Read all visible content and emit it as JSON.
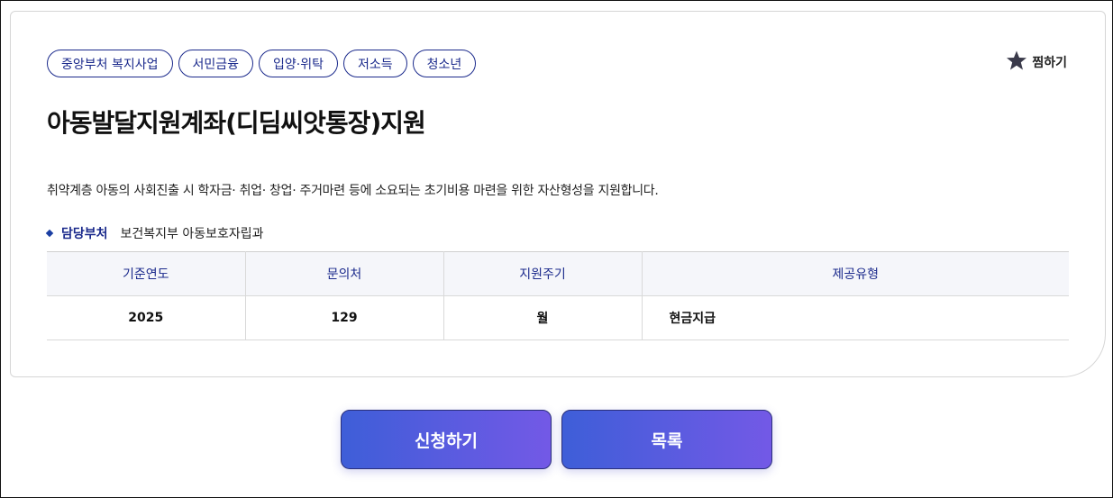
{
  "tags": [
    "중앙부처 복지사업",
    "서민금융",
    "입양·위탁",
    "저소득",
    "청소년"
  ],
  "bookmark": {
    "label": "찜하기",
    "icon": "star-icon",
    "color": "#3a3a4a"
  },
  "title": "아동발달지원계좌(디딤씨앗통장)지원",
  "description": "취약계층 아동의 사회진출 시 학자금· 취업· 창업· 주거마련 등에 소요되는 초기비용 마련을 위한 자산형성을 지원합니다.",
  "department": {
    "label": "담당부처",
    "value": "보건복지부 아동보호자립과"
  },
  "table": {
    "headers": [
      "기준연도",
      "문의처",
      "지원주기",
      "제공유형"
    ],
    "row": [
      "2025",
      "129",
      "월",
      "현금지급"
    ]
  },
  "buttons": {
    "apply": "신청하기",
    "list": "목록"
  },
  "colors": {
    "accent": "#1b2a8c",
    "button_start": "#3e5ed8",
    "button_end": "#7359e6"
  }
}
